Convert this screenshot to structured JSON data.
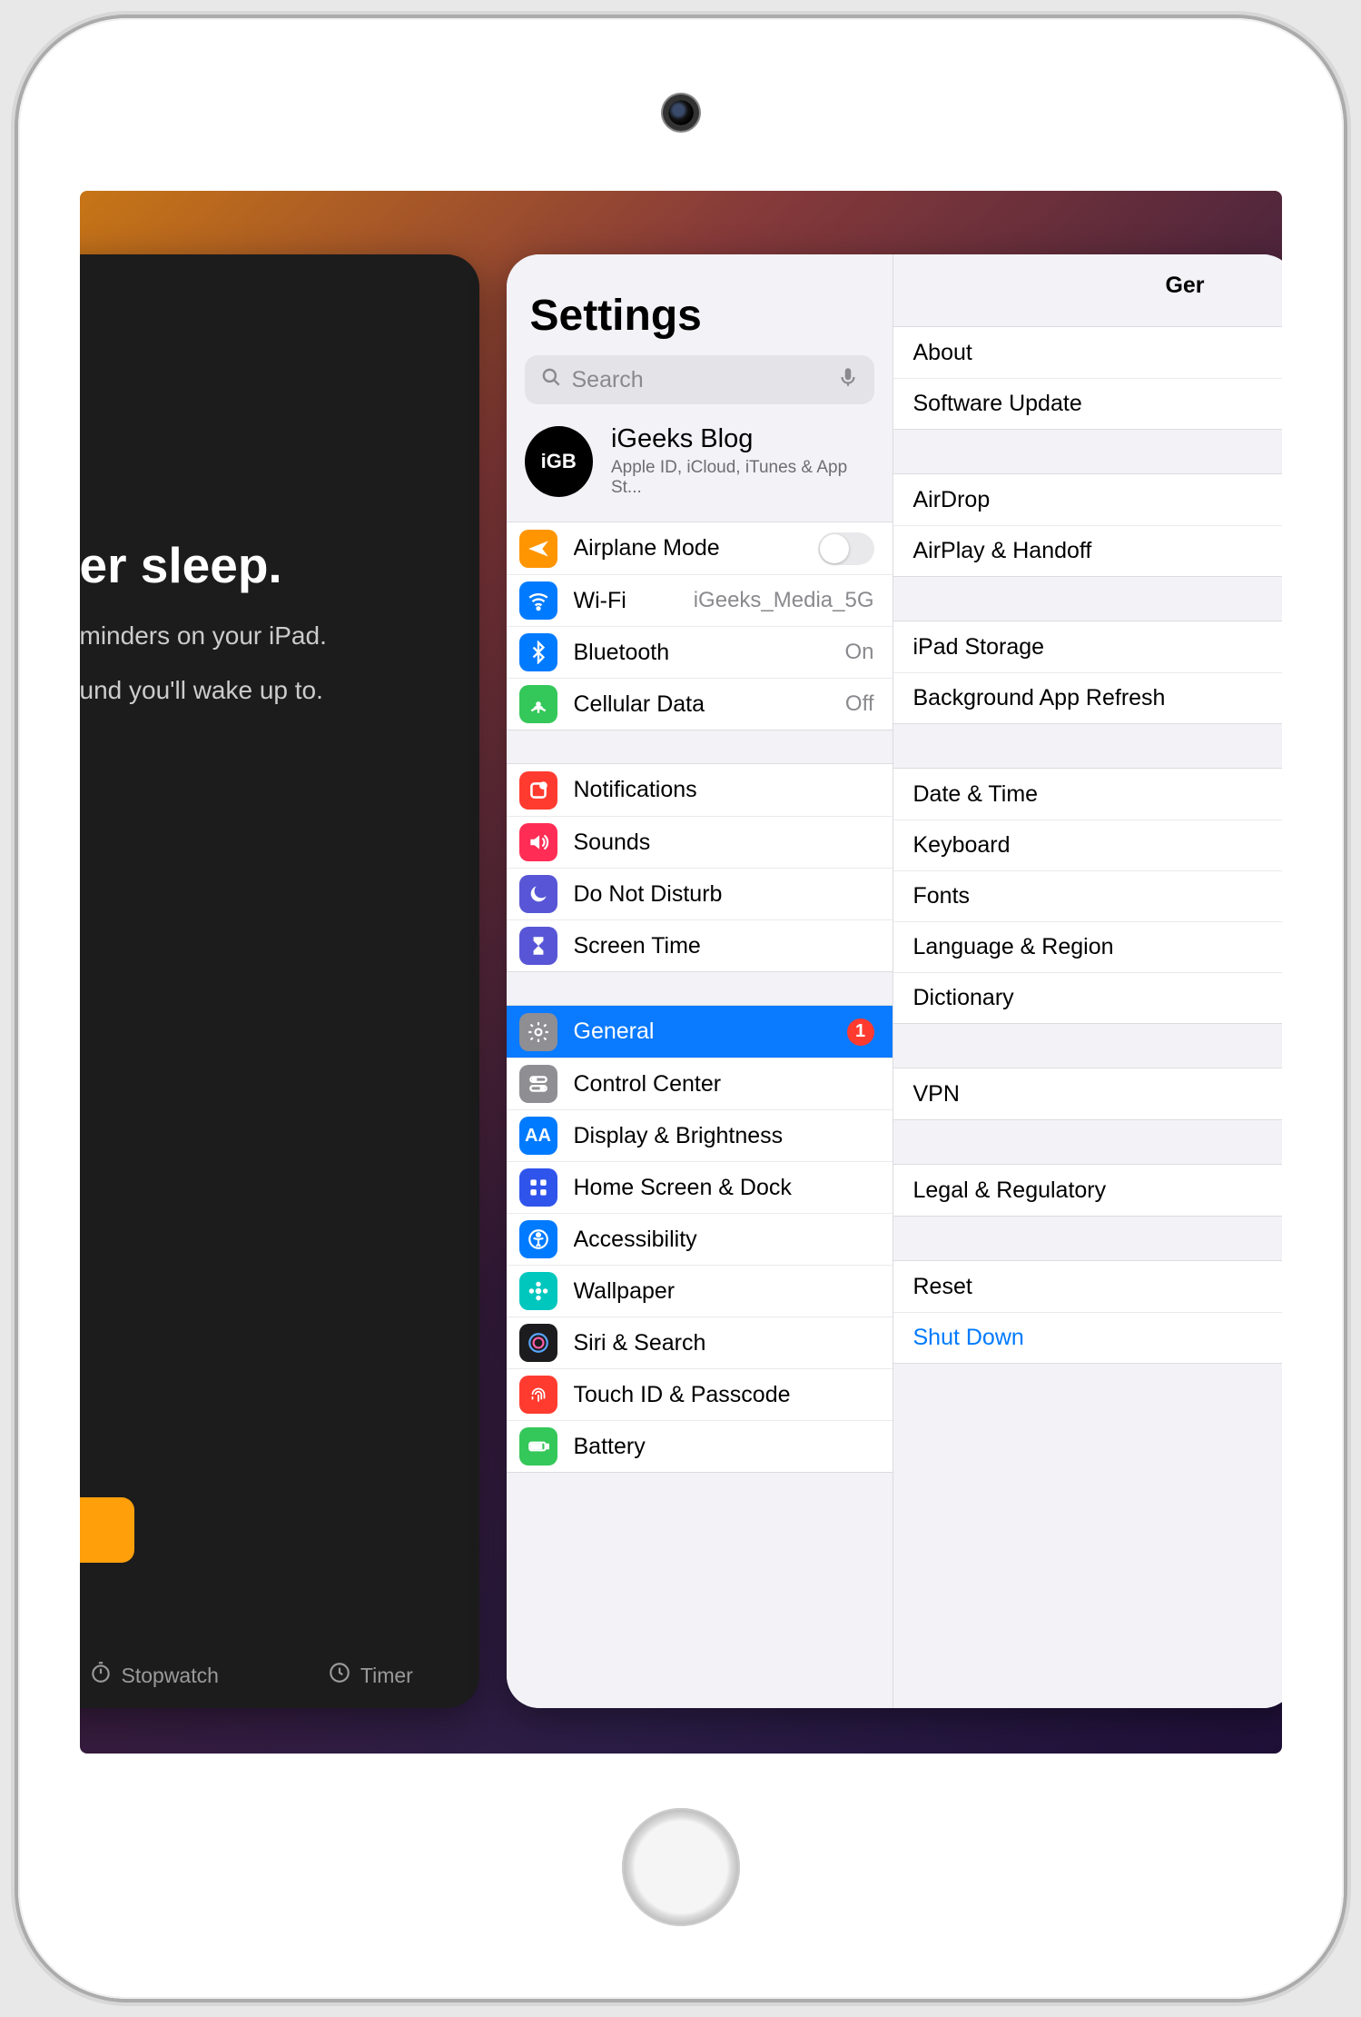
{
  "clock_card": {
    "heading_fragment": "er sleep.",
    "line1": "minders on your iPad.",
    "line2": "und you'll wake up to.",
    "tabs": {
      "stopwatch": "Stopwatch",
      "timer": "Timer"
    }
  },
  "settings": {
    "title": "Settings",
    "search_placeholder": "Search",
    "profile": {
      "avatar_text": "iGB",
      "name": "iGeeks Blog",
      "subtitle": "Apple ID, iCloud, iTunes & App St..."
    },
    "group_network": {
      "airplane": "Airplane Mode",
      "wifi": "Wi-Fi",
      "wifi_value": "iGeeks_Media_5G",
      "bluetooth": "Bluetooth",
      "bluetooth_value": "On",
      "cellular": "Cellular Data",
      "cellular_value": "Off"
    },
    "group_alerts": {
      "notifications": "Notifications",
      "sounds": "Sounds",
      "dnd": "Do Not Disturb",
      "screen_time": "Screen Time"
    },
    "group_general": {
      "general": "General",
      "general_badge": "1",
      "control_center": "Control Center",
      "display": "Display & Brightness",
      "home_screen": "Home Screen & Dock",
      "accessibility": "Accessibility",
      "wallpaper": "Wallpaper",
      "siri": "Siri & Search",
      "touch_id": "Touch ID & Passcode",
      "battery": "Battery"
    }
  },
  "detail": {
    "title_fragment": "Ger",
    "group1": {
      "about": "About",
      "software_update": "Software Update"
    },
    "group2": {
      "airdrop": "AirDrop",
      "airplay": "AirPlay & Handoff"
    },
    "group3": {
      "storage": "iPad Storage",
      "bg_refresh": "Background App Refresh"
    },
    "group4": {
      "date_time": "Date & Time",
      "keyboard": "Keyboard",
      "fonts": "Fonts",
      "language": "Language & Region",
      "dictionary": "Dictionary"
    },
    "group5": {
      "vpn": "VPN"
    },
    "group6": {
      "legal": "Legal & Regulatory"
    },
    "group7": {
      "reset": "Reset",
      "shut_down": "Shut Down"
    }
  }
}
